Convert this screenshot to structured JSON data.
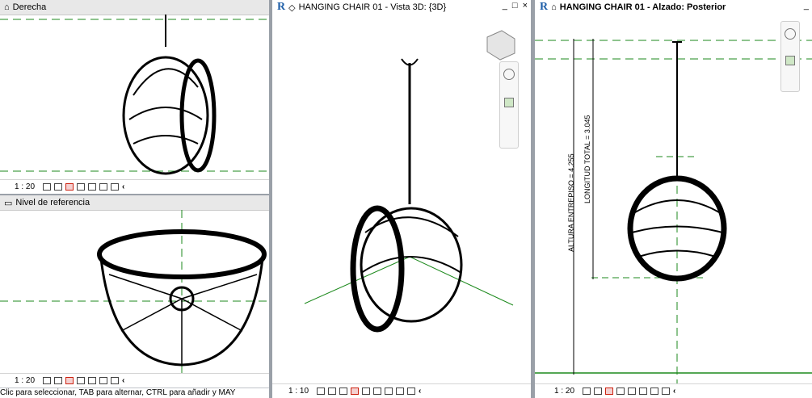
{
  "views": {
    "derecha": {
      "title": "Derecha",
      "scale": "1 : 20"
    },
    "nivel": {
      "title": "Nivel de referencia",
      "scale": "1 : 20"
    },
    "vista3d": {
      "title": "HANGING CHAIR 01 - Vista 3D: {3D}",
      "scale": "1 : 10"
    },
    "alzado": {
      "title": "HANGING CHAIR 01 - Alzado: Posterior",
      "scale": "1 : 20",
      "dim_altura": "ALTURA ENTREPISO = 4.255",
      "dim_longitud": "LONGITUD TOTAL = 3.045"
    }
  },
  "status": {
    "message": "Clic para seleccionar, TAB para alternar, CTRL para añadir y MAY"
  },
  "icons": {
    "view-icon": "house",
    "close": "×",
    "minimize": "_",
    "restore": "□",
    "chevron": "‹"
  },
  "colors": {
    "dash": "#1d8a1d",
    "revit": "#1f5fa8"
  }
}
